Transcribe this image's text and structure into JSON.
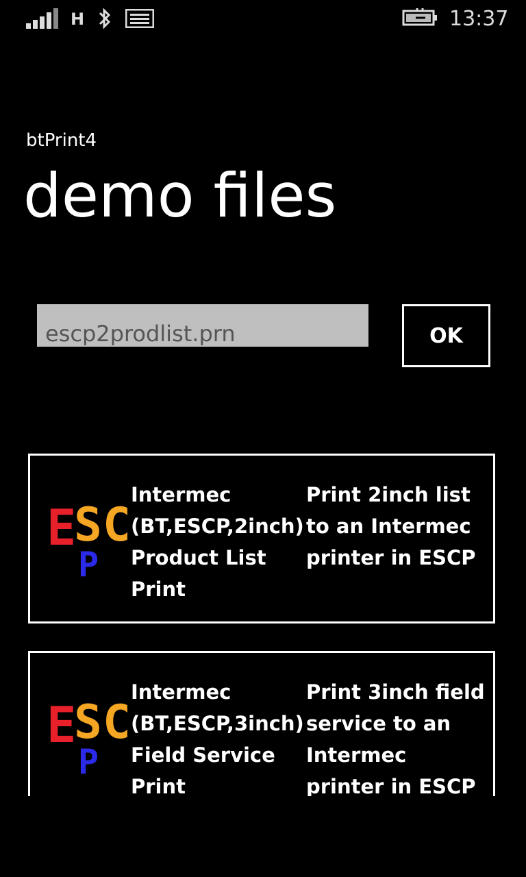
{
  "status_bar": {
    "network_type": "H",
    "time": "13:37",
    "icons": [
      "signal-strength-icon",
      "bluetooth-icon",
      "message-icon",
      "battery-charging-icon"
    ]
  },
  "app": {
    "name": "btPrint4",
    "page_title": "demo files"
  },
  "file_input": {
    "value": "escp2prodlist.prn"
  },
  "ok_button": {
    "label": "OK"
  },
  "demo_list": [
    {
      "logo_icon": "escp-logo-icon",
      "logo_text": [
        "E",
        "S",
        "C",
        "P"
      ],
      "name_lines": [
        "Intermec",
        "(BT,ESCP,2inch)",
        "Product List",
        "Print"
      ],
      "description_lines": [
        "Print 2inch list",
        "to an Intermec",
        "printer in ESCP"
      ]
    },
    {
      "logo_icon": "escp-logo-icon",
      "logo_text": [
        "E",
        "S",
        "C",
        "P"
      ],
      "name_lines": [
        "Intermec",
        "(BT,ESCP,3inch)",
        "Field Service",
        "Print"
      ],
      "description_lines": [
        "Print 3inch field",
        "service to an",
        "Intermec",
        "printer in ESCP"
      ]
    }
  ],
  "colors": {
    "background": "#000000",
    "foreground": "#ffffff",
    "input_background": "#bfbfbf",
    "logo_e": "#e8202a",
    "logo_sc": "#f5a623",
    "logo_p": "#2a2ae8"
  }
}
